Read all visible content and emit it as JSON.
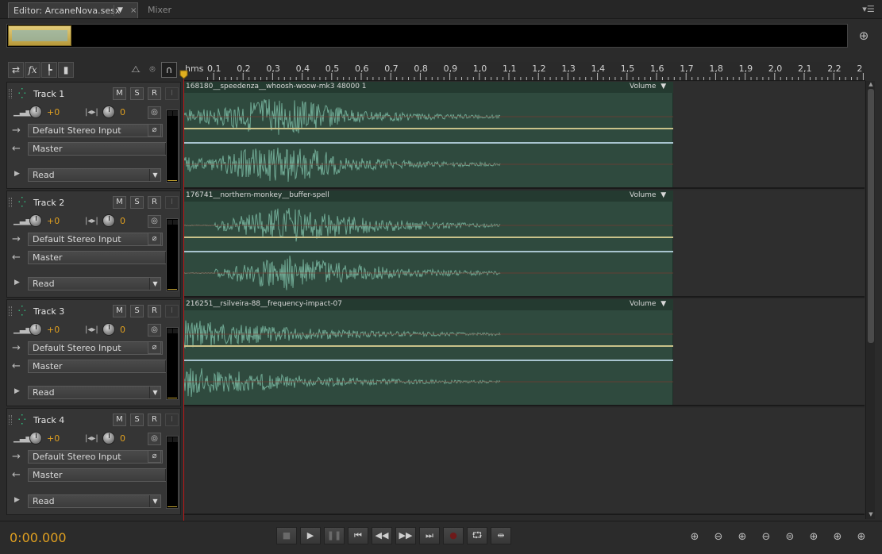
{
  "tabs": {
    "editor_label": "Editor: ArcaneNova.sesx",
    "mixer_label": "Mixer"
  },
  "ruler": {
    "unit": "hms",
    "ticks": [
      "0,1",
      "0,2",
      "0,3",
      "0,4",
      "0,5",
      "0,6",
      "0,7",
      "0,8",
      "0,9",
      "1,0",
      "1,1",
      "1,2",
      "1,3",
      "1,4",
      "1,5",
      "1,6",
      "1,7",
      "1,8",
      "1,9",
      "2,0",
      "2,1",
      "2,2",
      "2"
    ]
  },
  "tracks": [
    {
      "name": "Track 1",
      "volume": "+0",
      "pan": "0",
      "input": "Default Stereo Input",
      "output": "Master",
      "automation": "Read",
      "clip": {
        "name": "168180__speedenza__whoosh-woow-mk3 48000 1",
        "envelope": "Volume"
      }
    },
    {
      "name": "Track 2",
      "volume": "+0",
      "pan": "0",
      "input": "Default Stereo Input",
      "output": "Master",
      "automation": "Read",
      "clip": {
        "name": "176741__northern-monkey__buffer-spell",
        "envelope": "Volume"
      }
    },
    {
      "name": "Track 3",
      "volume": "+0",
      "pan": "0",
      "input": "Default Stereo Input",
      "output": "Master",
      "automation": "Read",
      "clip": {
        "name": "216251__rsilveira-88__frequency-impact-07",
        "envelope": "Volume"
      }
    },
    {
      "name": "Track 4",
      "volume": "+0",
      "pan": "0",
      "input": "Default Stereo Input",
      "output": "Master",
      "automation": "Read",
      "clip": null
    }
  ],
  "track_buttons": {
    "mute": "M",
    "solo": "S",
    "record": "R",
    "input_monitor": "I"
  },
  "transport": {
    "time": "0:00.000"
  },
  "colors": {
    "accent": "#e0a020",
    "clip_bg": "#2f4a3e",
    "waveform": "#6fa893",
    "playhead": "#c01818",
    "pan_line": "#c9c28a",
    "vol_line": "#a8c4cf"
  }
}
